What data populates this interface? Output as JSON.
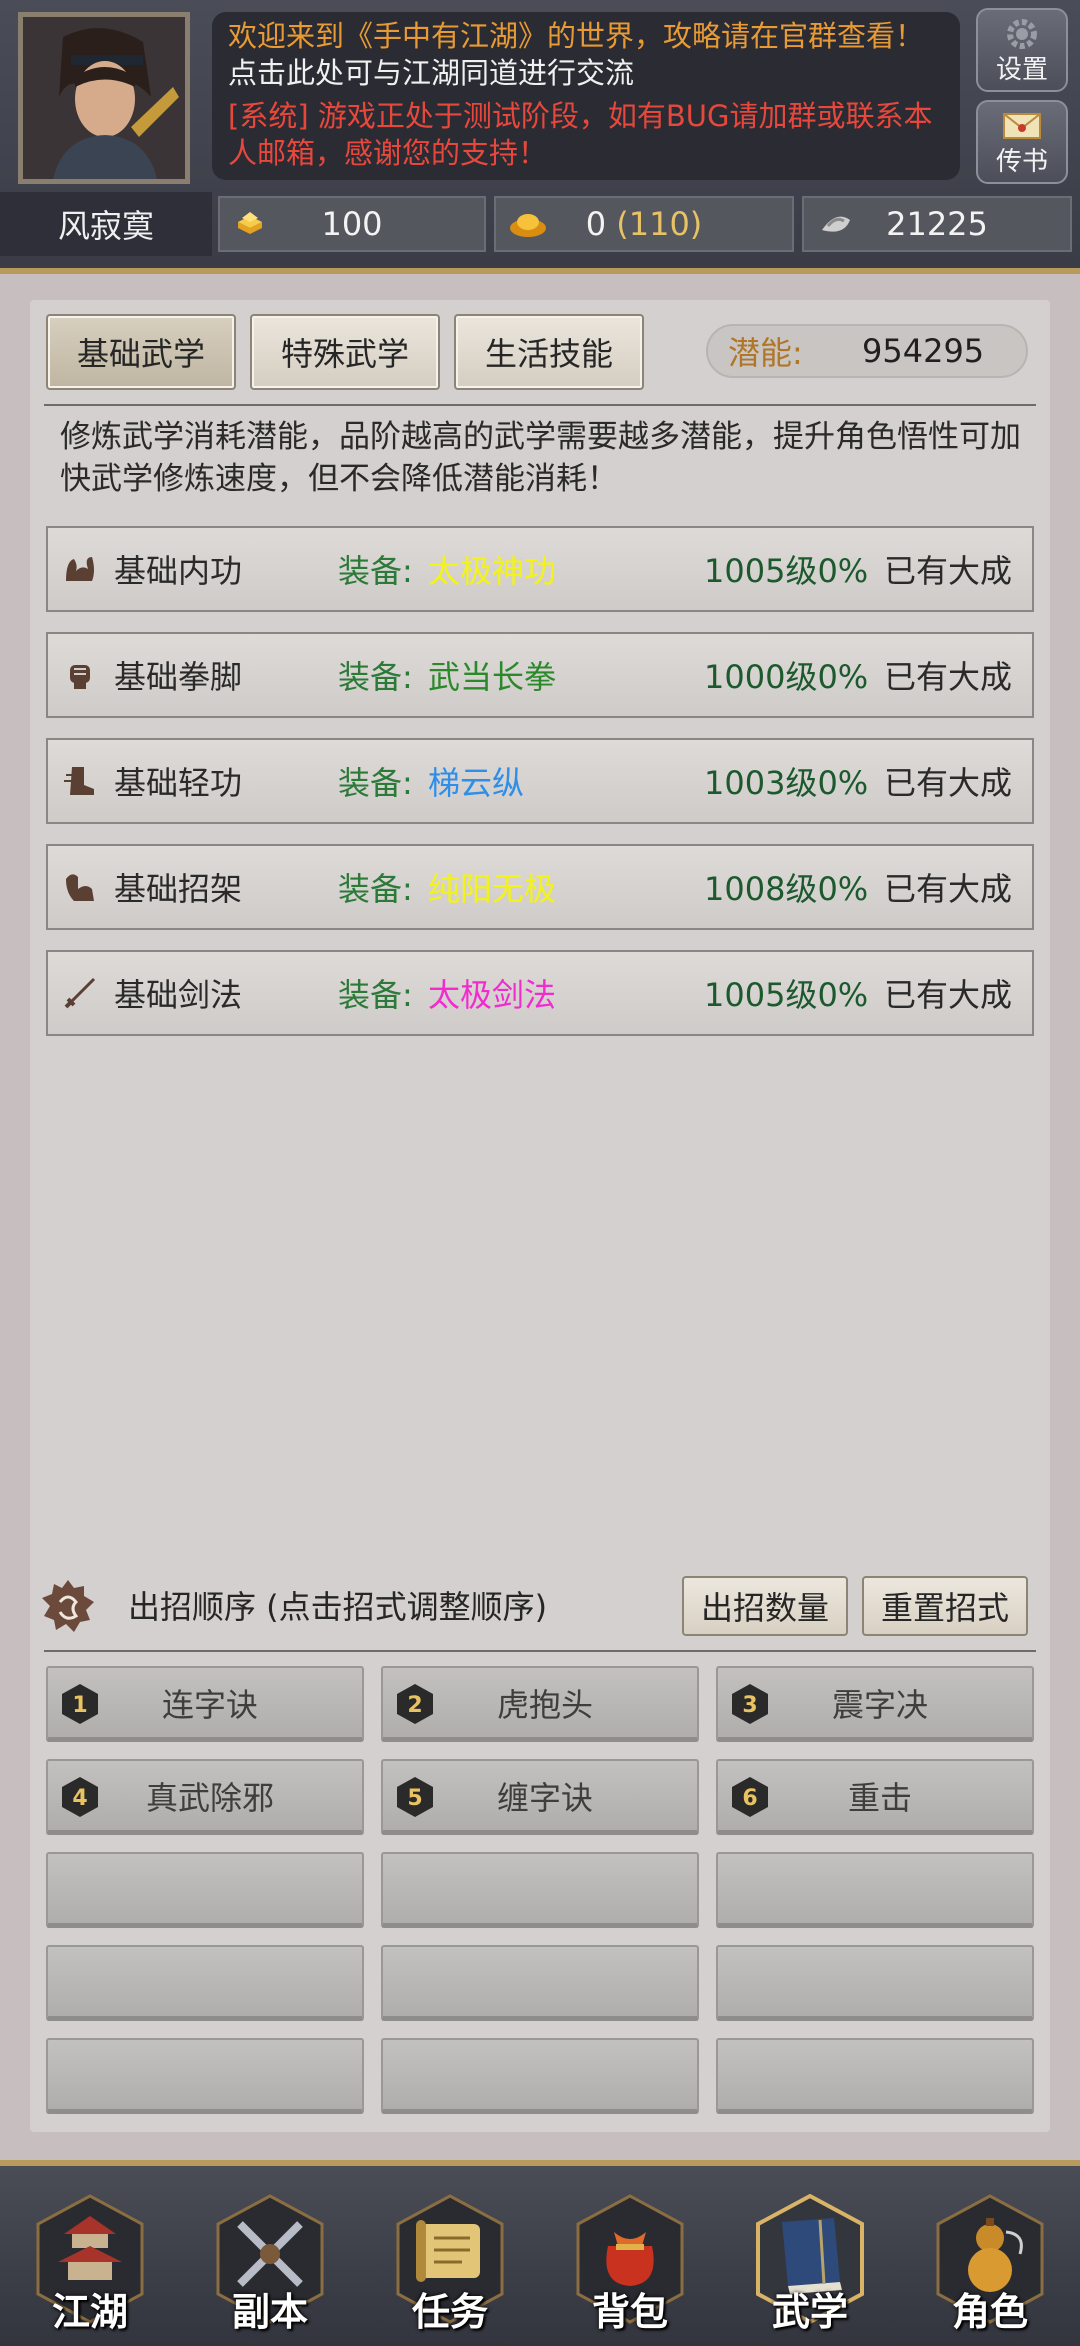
{
  "header": {
    "notice_line1": "欢迎来到《手中有江湖》的世界，攻略请在官群查看！",
    "notice_line2": "点击此处可与江湖同道进行交流",
    "notice_line3": "[系统] 游戏正处于测试阶段，如有BUG请加群或联系本人邮箱，感谢您的支持！",
    "settings_label": "设置",
    "mail_label": "传书",
    "player_name": "风寂寞"
  },
  "resources": {
    "gold_bars": "100",
    "ingot": "0",
    "ingot_extra": "(110)",
    "silver": "21225"
  },
  "tabs": [
    {
      "label": "基础武学",
      "active": true
    },
    {
      "label": "特殊武学",
      "active": false
    },
    {
      "label": "生活技能",
      "active": false
    }
  ],
  "potential": {
    "label": "潜能:",
    "value": "954295"
  },
  "description": "修炼武学消耗潜能，品阶越高的武学需要越多潜能，提升角色悟性可加快武学修炼速度，但不会降低潜能消耗！",
  "equip_label": "装备:",
  "skills": [
    {
      "name": "基础内功",
      "equipped": "太极神功",
      "color": "#f3f31a",
      "level": "1005级0%",
      "status": "已有大成",
      "icon": "muscle-icon"
    },
    {
      "name": "基础拳脚",
      "equipped": "武当长拳",
      "color": "#2a8a2a",
      "level": "1000级0%",
      "status": "已有大成",
      "icon": "fist-icon"
    },
    {
      "name": "基础轻功",
      "equipped": "梯云纵",
      "color": "#2f8fe8",
      "level": "1003级0%",
      "status": "已有大成",
      "icon": "boot-icon"
    },
    {
      "name": "基础招架",
      "equipped": "纯阳无极",
      "color": "#f3f31a",
      "level": "1008级0%",
      "status": "已有大成",
      "icon": "block-icon"
    },
    {
      "name": "基础剑法",
      "equipped": "太极剑法",
      "color": "#f02ccf",
      "level": "1005级0%",
      "status": "已有大成",
      "icon": "sword-icon"
    }
  ],
  "order": {
    "title": "出招顺序 (点击招式调整顺序)",
    "count_button": "出招数量",
    "reset_button": "重置招式",
    "moves": [
      {
        "num": "1",
        "name": "连字诀"
      },
      {
        "num": "2",
        "name": "虎抱头"
      },
      {
        "num": "3",
        "name": "震字决"
      },
      {
        "num": "4",
        "name": "真武除邪"
      },
      {
        "num": "5",
        "name": "缠字诀"
      },
      {
        "num": "6",
        "name": "重击"
      }
    ]
  },
  "nav": [
    {
      "label": "江湖",
      "icon": "pagoda-icon"
    },
    {
      "label": "副本",
      "icon": "swords-icon"
    },
    {
      "label": "任务",
      "icon": "scroll-icon"
    },
    {
      "label": "背包",
      "icon": "bag-icon"
    },
    {
      "label": "武学",
      "icon": "book-icon"
    },
    {
      "label": "角色",
      "icon": "gourd-icon"
    }
  ]
}
